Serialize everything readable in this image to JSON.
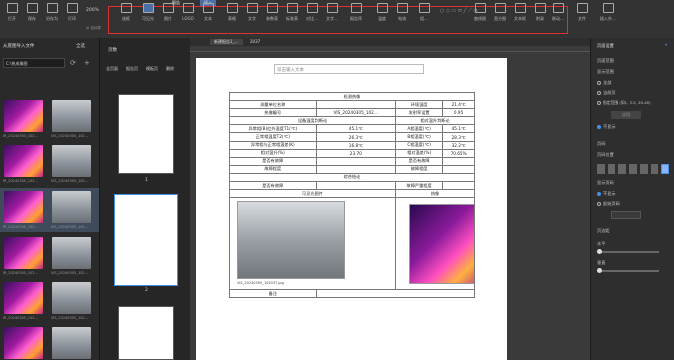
{
  "toolbar": {
    "left": [
      "打开",
      "保存",
      "另存为",
      "打印"
    ],
    "zoom_label": "200%",
    "zoom_sub": "AI 自动导",
    "tabs": [
      "报告",
      "插入"
    ],
    "items": [
      "选框",
      "可见光",
      "图片",
      "LOGO",
      "文本",
      "表格",
      "文字",
      "参数表",
      "标准表",
      "对比…",
      "文字…",
      "报告序",
      "温度",
      "电流",
      "组…",
      "曲线图",
      "直方图",
      "热点",
      "文本框",
      "附录",
      "联动…",
      "数据报告…"
    ],
    "right": [
      "文件",
      "插入外…"
    ]
  },
  "doc_tabs": [
    "新建报告1_…",
    "2037"
  ],
  "left_panel": {
    "title": "从底图导入文件",
    "select_all": "全选",
    "path": "C:\\热成像图",
    "captions": [
      "IR_20240303_102…",
      "VIS_20240305_102…",
      "IR_20240305_102…",
      "VIS_20240305_102…",
      "IR_20240305_102…",
      "VIS_20240305_102…",
      "IR_20240305_102…",
      "VIS_20240305_102…",
      "IR_20240305_102…",
      "VIS_20240305_102…",
      "IR_20240305_102…",
      "VIS_20240305_102…"
    ]
  },
  "mid_panel": {
    "title": "页数",
    "actions": [
      "全页面",
      "报告页",
      "模板页",
      "删除"
    ],
    "page_nums": [
      "1",
      "2"
    ]
  },
  "report": {
    "header_placeholder": "双击输入文本",
    "title": "检测热像",
    "rows": [
      [
        "测量单位名称",
        "",
        "环境温度",
        "21.4℃"
      ],
      [
        "热像编号",
        "VIS_20240305_102…",
        "发射率设置",
        "0.95"
      ],
      [
        "设备温度判断论",
        "",
        "相对温升判断论",
        ""
      ],
      [
        "异常相(B)红外温度T1(℃)",
        "45.1℃",
        "A相温度(℃)",
        "45.1℃"
      ],
      [
        "正常相温度T2(℃)",
        "26.3℃",
        "B相温度(℃)",
        "28.3℃"
      ],
      [
        "异常相与正常相温差(K)",
        "16.8℃",
        "C相温度(℃)",
        "32.2℃"
      ],
      [
        "相对温升(%)",
        "23.70",
        "相对温差(%)",
        "70.65%"
      ],
      [
        "是否有故障",
        "",
        "是否有故障",
        ""
      ],
      [
        "故障程度",
        "",
        "故障程度",
        ""
      ]
    ],
    "summary_title": "综合结论",
    "summary_row": [
      "是否有故障",
      "",
      "故障严重程度",
      ""
    ],
    "img_headers": [
      "可见光图片",
      "热像"
    ],
    "img_caption": "VIS_20240305_102037.jpg",
    "notes_label": "备注"
  },
  "right_panel": {
    "title": "页面设置",
    "sections": {
      "page_range": "页面范围",
      "display_range": "显示范围",
      "opt_all": "全部",
      "opt_cur": "当前页",
      "opt_custom": "指定范围 (如1, 3-5, 20-40)",
      "apply": "应用",
      "no_display": "不显示",
      "page_num": "页码",
      "page_pos": "页码位置",
      "display_pos": "显示页码",
      "no_show": "不显示",
      "first_page": "起始页码",
      "align": "页边距",
      "horiz": "水平",
      "vert": "垂直"
    }
  }
}
